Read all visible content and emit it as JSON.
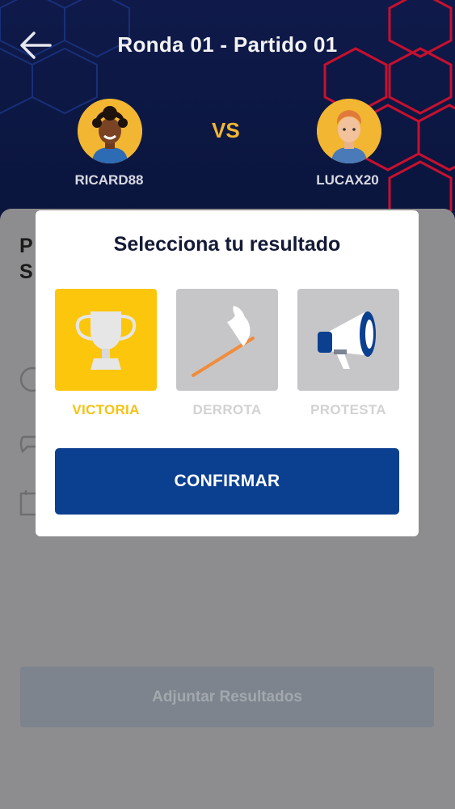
{
  "header": {
    "title": "Ronda 01 - Partido 01",
    "vs_label": "VS",
    "player_left": {
      "name": "RICARD88"
    },
    "player_right": {
      "name": "LUCAX20"
    }
  },
  "background": {
    "heading_partial": "P\nS",
    "attach_button_label": "Adjuntar Resultados"
  },
  "modal": {
    "title": "Selecciona tu resultado",
    "options": [
      {
        "label": "VICTORIA",
        "icon": "trophy-icon",
        "selected": true
      },
      {
        "label": "DERROTA",
        "icon": "white-flag-icon",
        "selected": false
      },
      {
        "label": "PROTESTA",
        "icon": "megaphone-icon",
        "selected": false
      }
    ],
    "confirm_label": "CONFIRMAR"
  },
  "colors": {
    "header_bg": "#0f1a4a",
    "accent_yellow": "#fcc60c",
    "primary_blue": "#0b3f90",
    "hex_blue": "#1e3a8a",
    "hex_red": "#c8102e"
  }
}
